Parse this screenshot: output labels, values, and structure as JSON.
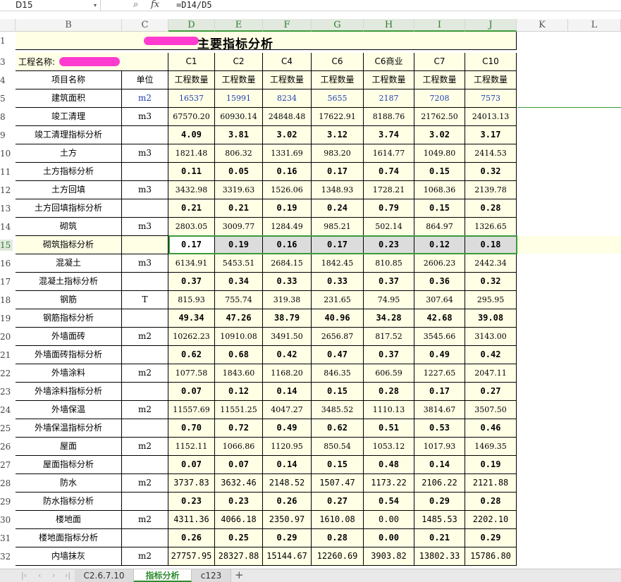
{
  "formula_bar": {
    "cell_ref": "D15",
    "fx": "fx",
    "formula": "=D14/D5"
  },
  "column_headers": [
    "B",
    "C",
    "D",
    "E",
    "F",
    "G",
    "H",
    "I",
    "J",
    "K",
    "L"
  ],
  "selected_columns": [
    "D",
    "E",
    "F",
    "G",
    "H",
    "I",
    "J"
  ],
  "row_headers": [
    "1",
    "3",
    "4",
    "5",
    "8",
    "9",
    "10",
    "11",
    "12",
    "13",
    "14",
    "15",
    "16",
    "17",
    "18",
    "19",
    "20",
    "21",
    "22",
    "23",
    "24",
    "25",
    "26",
    "27",
    "28",
    "29",
    "30",
    "31",
    "32"
  ],
  "selected_row": "15",
  "sheet": {
    "title": "主要指标分析",
    "project_label": "工程名称:",
    "headers": {
      "item": "项目名称",
      "unit": "单位",
      "sub": "工程数量",
      "buildings": [
        "C1",
        "C2",
        "C4",
        "C6",
        "C6商业",
        "C7",
        "C10"
      ]
    },
    "rows": [
      {
        "name": "建筑面积",
        "unit": "m2",
        "style": "area",
        "values": [
          "16537",
          "15991",
          "8234",
          "5655",
          "2187",
          "7208",
          "7573"
        ]
      },
      {
        "name": "竣工清理",
        "unit": "m3",
        "style": "num",
        "values": [
          "67570.20",
          "60930.14",
          "24848.48",
          "17622.91",
          "8188.76",
          "21762.50",
          "24013.13"
        ]
      },
      {
        "name": "竣工清理指标分析",
        "unit": "",
        "style": "bold",
        "values": [
          "4.09",
          "3.81",
          "3.02",
          "3.12",
          "3.74",
          "3.02",
          "3.17"
        ]
      },
      {
        "name": "土方",
        "unit": "m3",
        "style": "num",
        "values": [
          "1821.48",
          "806.32",
          "1331.69",
          "983.20",
          "1614.77",
          "1049.80",
          "2414.53"
        ]
      },
      {
        "name": "土方指标分析",
        "unit": "",
        "style": "bold",
        "values": [
          "0.11",
          "0.05",
          "0.16",
          "0.17",
          "0.74",
          "0.15",
          "0.32"
        ]
      },
      {
        "name": "土方回填",
        "unit": "m3",
        "style": "num",
        "values": [
          "3432.98",
          "3319.63",
          "1526.06",
          "1348.93",
          "1728.21",
          "1068.36",
          "2139.78"
        ]
      },
      {
        "name": "土方回填指标分析",
        "unit": "",
        "style": "bold",
        "values": [
          "0.21",
          "0.21",
          "0.19",
          "0.24",
          "0.79",
          "0.15",
          "0.28"
        ]
      },
      {
        "name": "砌筑",
        "unit": "m3",
        "style": "num",
        "values": [
          "2803.05",
          "3009.77",
          "1284.49",
          "985.21",
          "502.14",
          "864.97",
          "1326.65"
        ]
      },
      {
        "name": "砌筑指标分析",
        "unit": "",
        "style": "bold",
        "values": [
          "0.17",
          "0.19",
          "0.16",
          "0.17",
          "0.23",
          "0.12",
          "0.18"
        ]
      },
      {
        "name": "混凝土",
        "unit": "m3",
        "style": "num",
        "values": [
          "6134.91",
          "5453.51",
          "2684.15",
          "1842.45",
          "810.85",
          "2606.23",
          "2442.34"
        ]
      },
      {
        "name": "混凝土指标分析",
        "unit": "",
        "style": "bold",
        "values": [
          "0.37",
          "0.34",
          "0.33",
          "0.33",
          "0.37",
          "0.36",
          "0.32"
        ]
      },
      {
        "name": "钢筋",
        "unit": "T",
        "style": "num",
        "values": [
          "815.93",
          "755.74",
          "319.38",
          "231.65",
          "74.95",
          "307.64",
          "295.95"
        ]
      },
      {
        "name": "钢筋指标分析",
        "unit": "",
        "style": "bold",
        "values": [
          "49.34",
          "47.26",
          "38.79",
          "40.96",
          "34.28",
          "42.68",
          "39.08"
        ]
      },
      {
        "name": "外墙面砖",
        "unit": "m2",
        "style": "num",
        "values": [
          "10262.23",
          "10910.08",
          "3491.50",
          "2656.87",
          "817.52",
          "3545.66",
          "3143.00"
        ]
      },
      {
        "name": "外墙面砖指标分析",
        "unit": "",
        "style": "bold",
        "values": [
          "0.62",
          "0.68",
          "0.42",
          "0.47",
          "0.37",
          "0.49",
          "0.42"
        ]
      },
      {
        "name": "外墙涂料",
        "unit": "m2",
        "style": "num",
        "values": [
          "1077.58",
          "1843.60",
          "1168.20",
          "846.35",
          "606.59",
          "1227.65",
          "2047.11"
        ]
      },
      {
        "name": "外墙涂料指标分析",
        "unit": "",
        "style": "bold",
        "values": [
          "0.07",
          "0.12",
          "0.14",
          "0.15",
          "0.28",
          "0.17",
          "0.27"
        ]
      },
      {
        "name": "外墙保温",
        "unit": "m2",
        "style": "num",
        "values": [
          "11557.69",
          "11551.25",
          "4047.27",
          "3485.52",
          "1110.13",
          "3814.67",
          "3507.50"
        ]
      },
      {
        "name": "外墙保温指标分析",
        "unit": "",
        "style": "bold",
        "values": [
          "0.70",
          "0.72",
          "0.49",
          "0.62",
          "0.51",
          "0.53",
          "0.46"
        ]
      },
      {
        "name": "屋面",
        "unit": "m2",
        "style": "num",
        "values": [
          "1152.11",
          "1066.86",
          "1120.95",
          "850.54",
          "1053.12",
          "1017.93",
          "1469.35"
        ]
      },
      {
        "name": "屋面指标分析",
        "unit": "",
        "style": "bold",
        "values": [
          "0.07",
          "0.07",
          "0.14",
          "0.15",
          "0.48",
          "0.14",
          "0.19"
        ]
      },
      {
        "name": "防水",
        "unit": "m2",
        "style": "mono",
        "values": [
          "3737.83",
          "3632.46",
          "2148.52",
          "1507.47",
          "1173.22",
          "2106.22",
          "2121.88"
        ]
      },
      {
        "name": "防水指标分析",
        "unit": "",
        "style": "bold",
        "values": [
          "0.23",
          "0.23",
          "0.26",
          "0.27",
          "0.54",
          "0.29",
          "0.28"
        ]
      },
      {
        "name": "楼地面",
        "unit": "m2",
        "style": "mono",
        "values": [
          "4311.36",
          "4066.18",
          "2350.97",
          "1610.08",
          "0.00",
          "1485.53",
          "2202.10"
        ]
      },
      {
        "name": "楼地面指标分析",
        "unit": "",
        "style": "bold",
        "values": [
          "0.26",
          "0.25",
          "0.29",
          "0.28",
          "0.00",
          "0.21",
          "0.29"
        ]
      },
      {
        "name": "内墙抹灰",
        "unit": "m2",
        "style": "mono",
        "values": [
          "27757.95",
          "28327.88",
          "15144.67",
          "12260.69",
          "3903.82",
          "13802.33",
          "15786.80"
        ]
      }
    ]
  },
  "sheet_tabs": [
    "C2.6.7.10",
    "指标分析",
    "c123"
  ],
  "active_tab": "指标分析",
  "colors": {
    "cell_fill": "#ffffe6",
    "selection_green": "#3a9a3a",
    "area_blue": "#1f3fb5",
    "redaction_pink": "#ff3ccf"
  },
  "icons": [
    "zoom-icon",
    "fx-icon",
    "chevron-down-icon",
    "add-sheet-icon"
  ]
}
